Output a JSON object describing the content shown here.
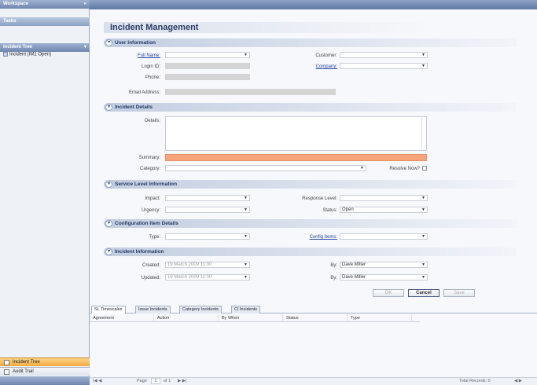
{
  "left": {
    "header1": "Workspace",
    "header1_x": "«",
    "header2": "Tasks",
    "header3": "Incident Tree",
    "tree_item": "Incident (IM1 Open)",
    "btn_incident_tree": "Incident Tree",
    "btn_audit_trail": "Audit Trail"
  },
  "form": {
    "title": "Incident Management",
    "sec_user": "User Information",
    "full_name": "Full Name:",
    "customer": "Customer:",
    "login_id": "Login ID:",
    "company": "Company:",
    "phone": "Phone:",
    "email": "Email Address:",
    "sec_incident": "Incident Details",
    "details": "Details:",
    "summary": "Summary:",
    "category": "Category:",
    "resolve_now": "Resolve Now?",
    "sec_service": "Service Level Information",
    "impact": "Impact:",
    "response_level": "Response Level:",
    "urgency": "Urgency:",
    "status": "Status:",
    "status_value": "Open",
    "sec_config": "Configuration Item Details",
    "type": "Type:",
    "config_items": "Config Items:",
    "sec_info": "Incident Information",
    "created": "Created:",
    "created_value": "19 March 2009 11:00",
    "updated": "Updated:",
    "updated_value": "19 March 2009 11:00",
    "by1": "By:",
    "by1_value": "Dave Miller",
    "by2": "By:",
    "by2_value": "Dave Miller",
    "ok": "OK",
    "cancel": "Cancel",
    "save": "Save"
  },
  "tabs": [
    "SL Timescales",
    "Issue Incidents",
    "Category Incidents",
    "CI Incidents"
  ],
  "grid_headers": [
    "Agreement",
    "Action",
    "By When",
    "Status",
    "Type"
  ],
  "pager": {
    "page_label": "Page",
    "page_value": "1",
    "of_label": "of 1",
    "total": "Total Records: 0"
  }
}
